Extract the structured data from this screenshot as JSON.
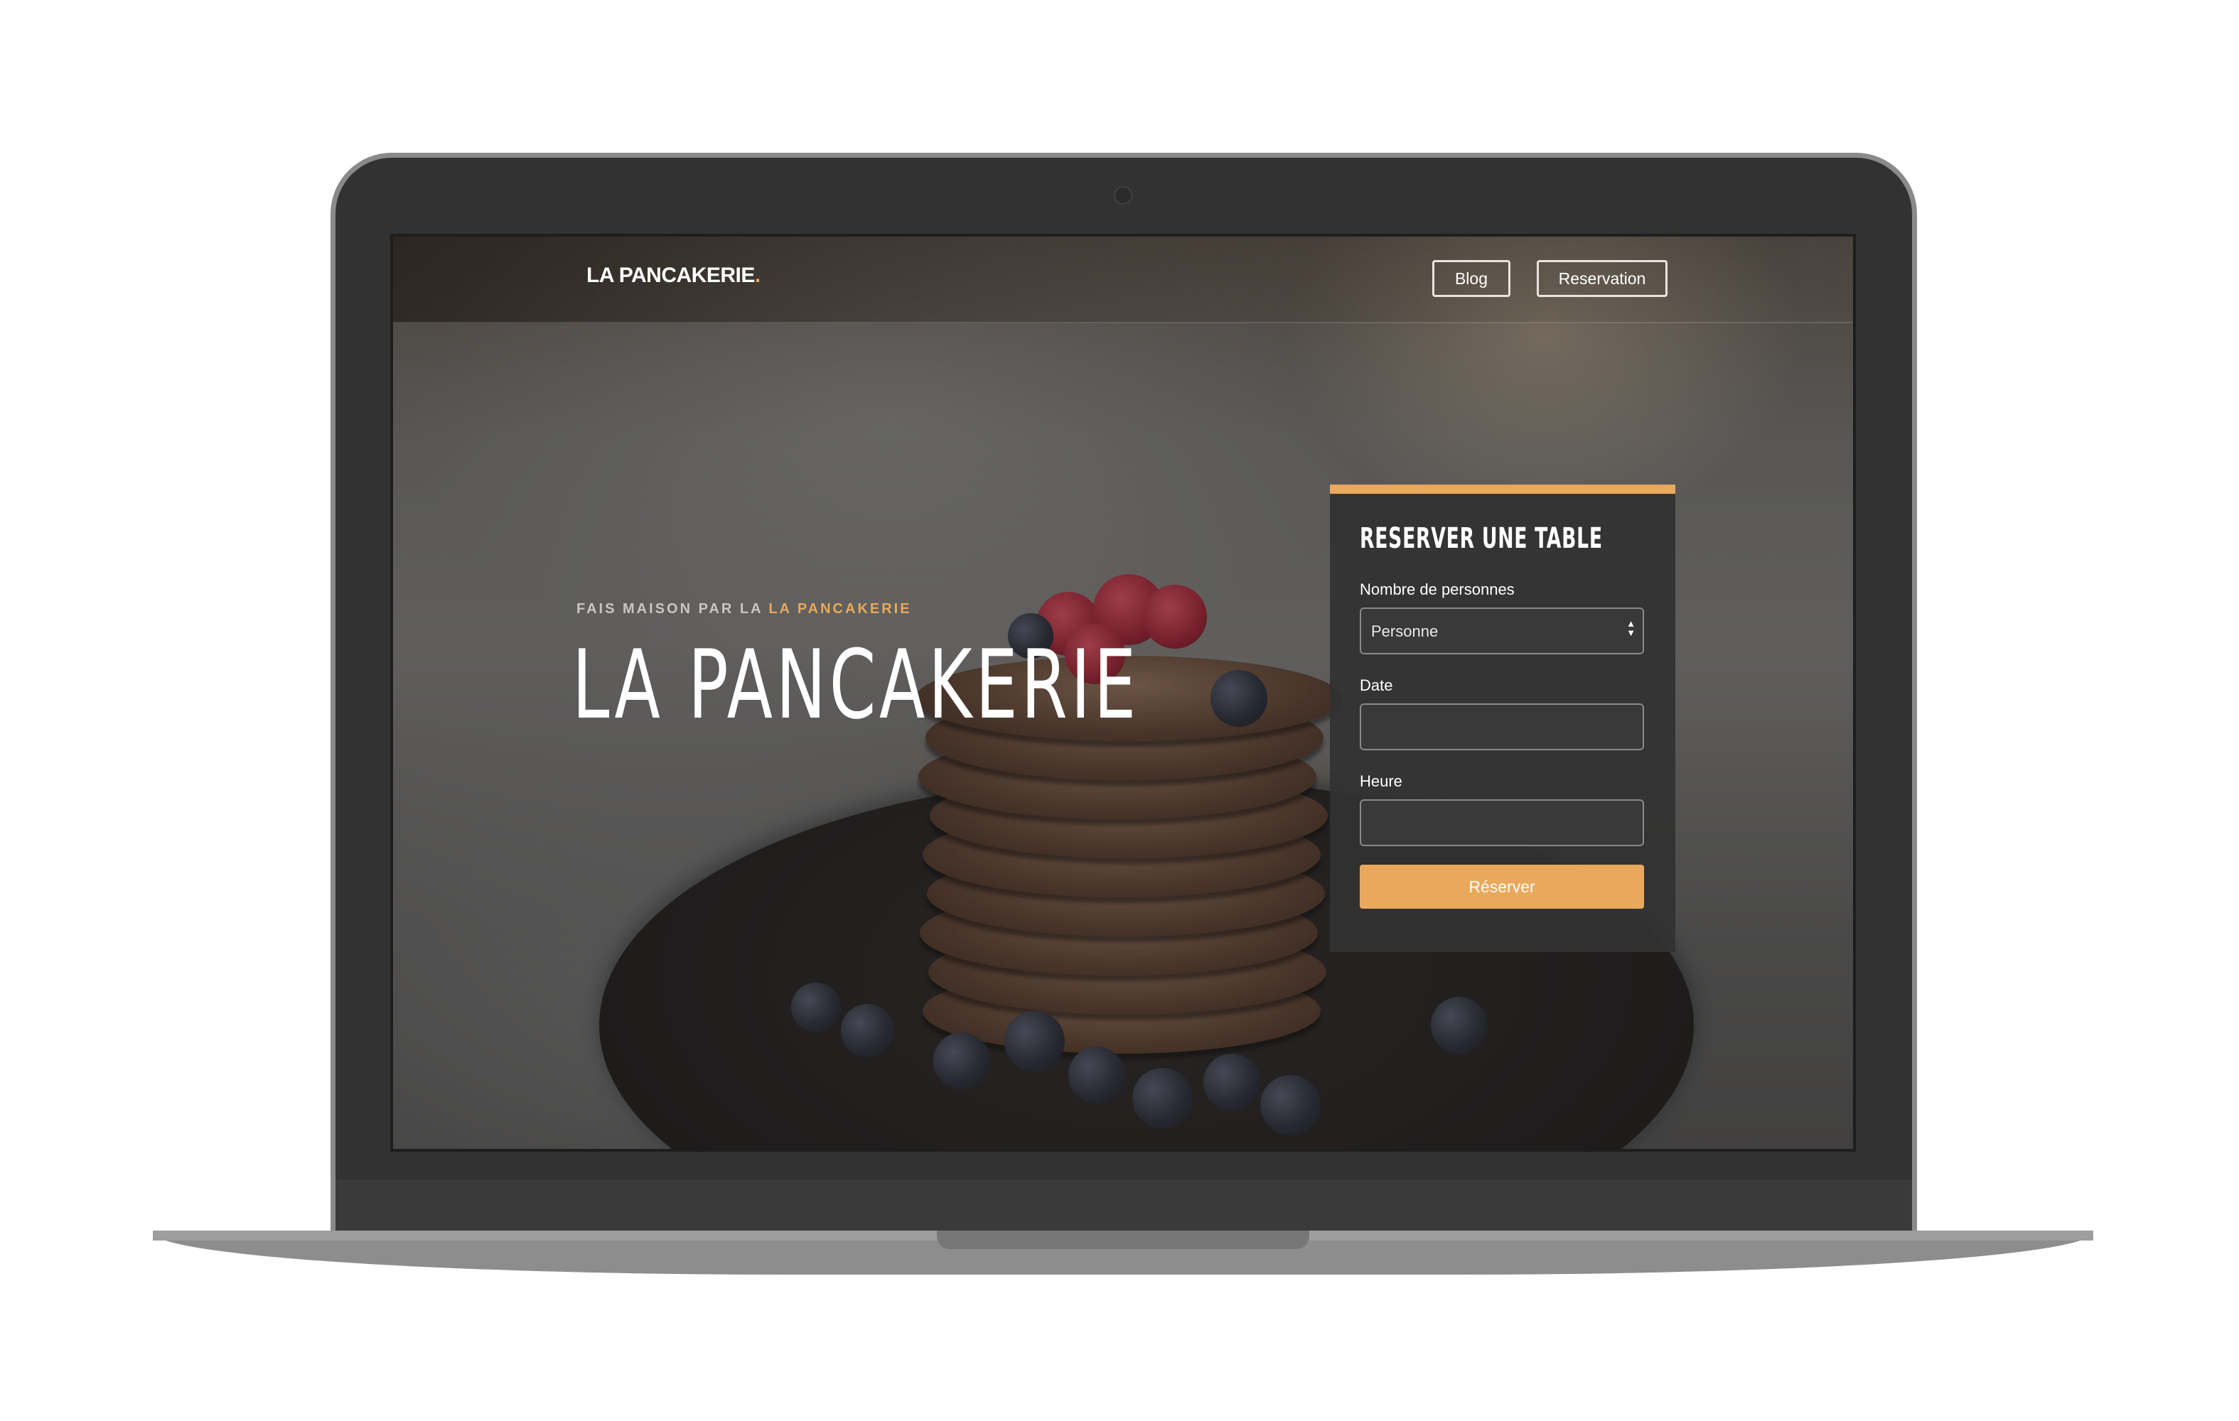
{
  "nav": {
    "brand": "LA PANCAKERIE",
    "brand_dot": ".",
    "blog_label": "Blog",
    "reservation_label": "Reservation"
  },
  "hero": {
    "kicker_prefix": "FAIS MAISON PAR LA ",
    "kicker_accent": "LA PANCAKERIE",
    "title": "LA PANCAKERIE"
  },
  "booking": {
    "title": "RESERVER UNE TABLE",
    "persons_label": "Nombre de personnes",
    "persons_value": "Personne",
    "date_label": "Date",
    "date_value": "",
    "time_label": "Heure",
    "time_value": "",
    "submit_label": "Réserver"
  },
  "colors": {
    "accent": "#e9a85c",
    "card_bg": "#323232",
    "laptop_body": "#323232"
  }
}
